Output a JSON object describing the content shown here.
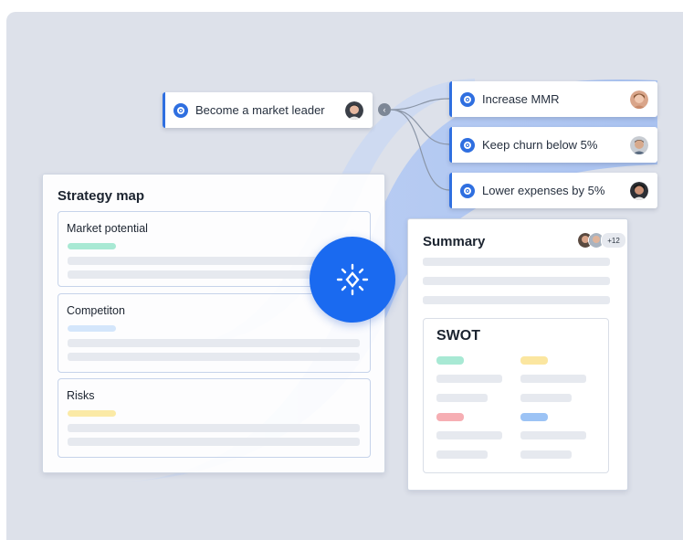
{
  "goals": {
    "root": {
      "label": "Become a market leader",
      "avatar_icon": "person-avatar"
    },
    "children": [
      {
        "label": "Increase MMR",
        "avatar_icon": "person-avatar"
      },
      {
        "label": "Keep churn below 5%",
        "avatar_icon": "person-avatar"
      },
      {
        "label": "Lower expenses by 5%",
        "avatar_icon": "person-avatar"
      }
    ]
  },
  "strategy_map": {
    "title": "Strategy map",
    "sections": [
      {
        "label": "Market potential",
        "tag_color": "#a8e9d4"
      },
      {
        "label": "Competiton",
        "tag_color": "#d4e6fb"
      },
      {
        "label": "Risks",
        "tag_color": "#fbeaa6"
      }
    ]
  },
  "summary": {
    "title": "Summary",
    "collaborators_more": "+12",
    "swot": {
      "title": "SWOT",
      "tag_colors": [
        "#a8e9d4",
        "#fbe6a0",
        "#f6aeb3",
        "#9cc3f5"
      ]
    }
  },
  "colors": {
    "accent": "#2f6fe0",
    "ai_button": "#1a6af0",
    "ribbon": "#b9cdf4",
    "canvas": "#dde1ea"
  },
  "icons": {
    "ai_button": "sparkle-icon",
    "collapse": "chevron-left-icon",
    "goal": "target-icon"
  }
}
